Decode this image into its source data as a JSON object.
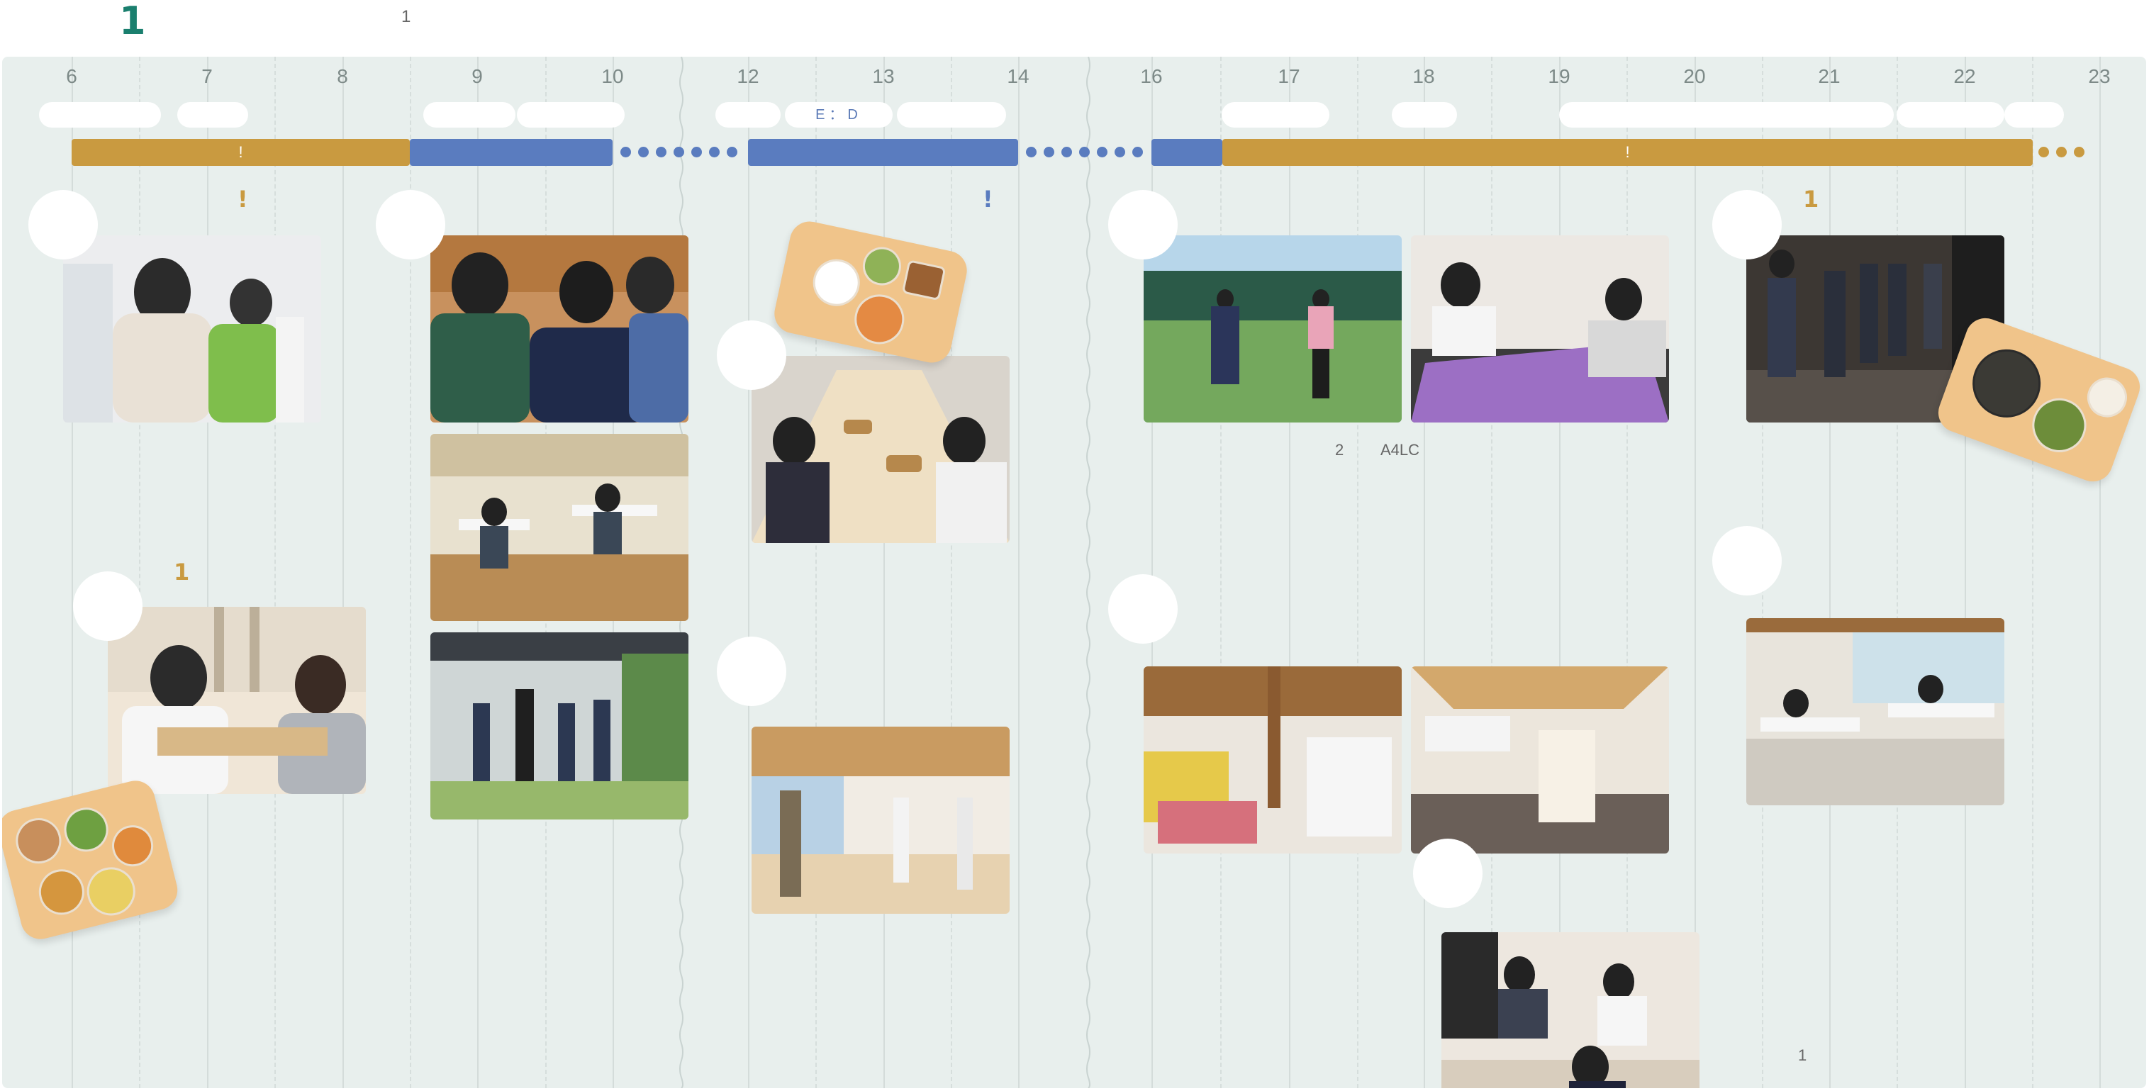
{
  "header": {
    "title": "1",
    "subtitle": "1"
  },
  "timeline": {
    "hours": [
      "6",
      "7",
      "8",
      "9",
      "10",
      "12",
      "13",
      "14",
      "16",
      "17",
      "18",
      "19",
      "20",
      "21",
      "22",
      "23"
    ],
    "pill_text": "E：D",
    "bar_marks": [
      "!",
      "!"
    ]
  },
  "accents": {
    "morning": "!",
    "midday": "!",
    "evening": "1",
    "breakfast": "1"
  },
  "notes": {
    "count": "2",
    "paper": "A4LC",
    "bottom": "1"
  },
  "photos": [
    "washing-face-photo",
    "students-talking-photo",
    "classroom-photo",
    "entrance-photo",
    "lunch-photo",
    "gym-photo",
    "tennis-photo",
    "board-game-photo",
    "dinner-line-photo",
    "study-room-photo",
    "kitchen-photo",
    "bathroom-photo",
    "lounge-photo",
    "breakfast-photo"
  ],
  "colors": {
    "accent": "#1a7f6e",
    "gold": "#c99a40",
    "blue": "#5a7cbf",
    "board": "#e8efed"
  }
}
